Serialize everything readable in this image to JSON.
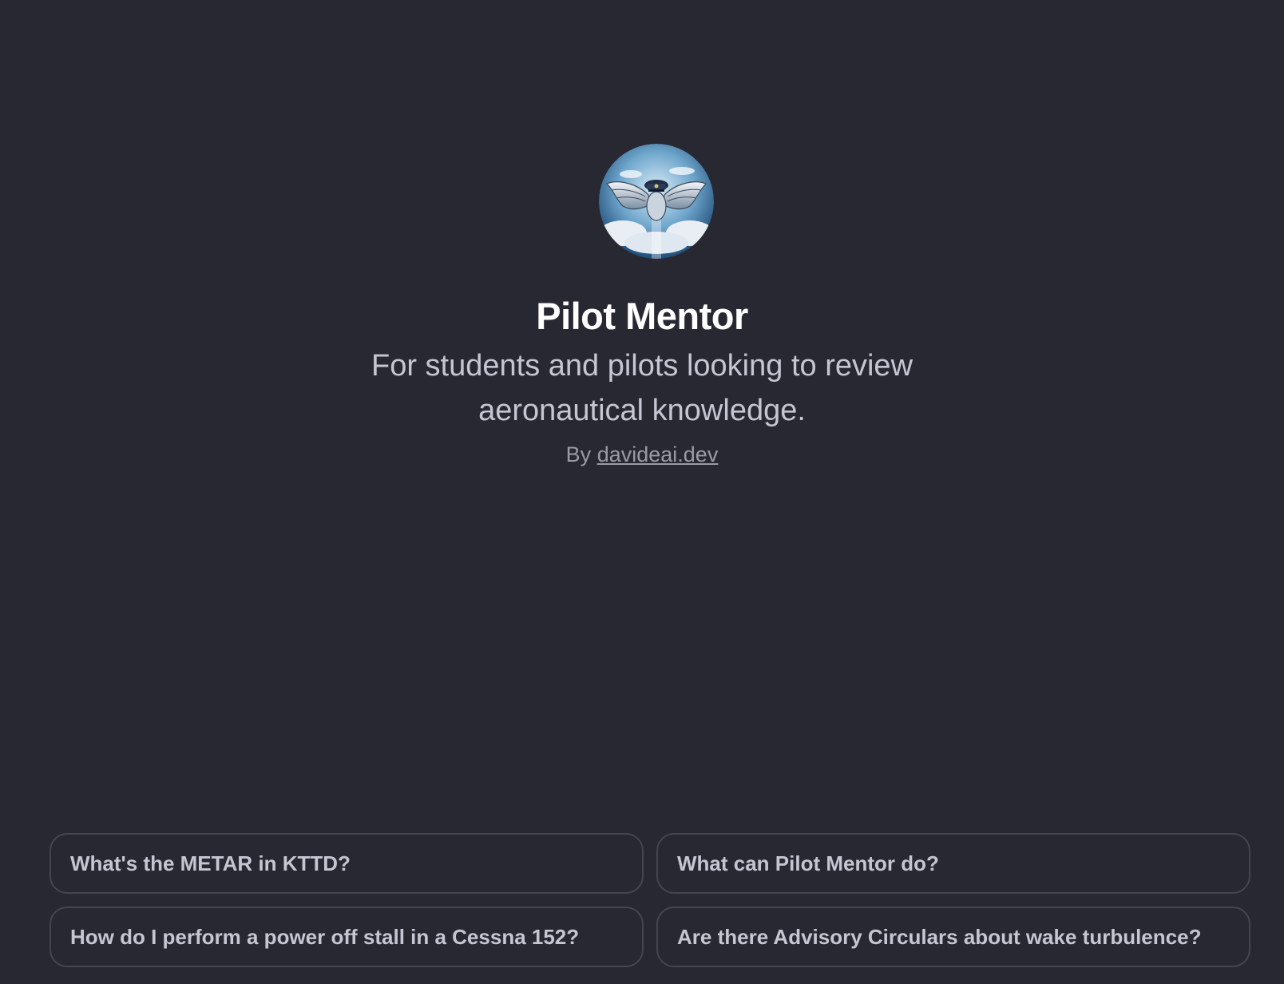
{
  "gpt": {
    "avatar_icon": "pilot-wings-emblem-icon",
    "name": "Pilot Mentor",
    "description": "For students and pilots looking to review aeronautical knowledge.",
    "by_prefix": "By",
    "author": "davideai.dev"
  },
  "prompts": [
    {
      "label": "What's the METAR in KTTD?"
    },
    {
      "label": "What can Pilot Mentor do?"
    },
    {
      "label": "How do I perform a power off stall in a Cessna 152?"
    },
    {
      "label": "Are there Advisory Circulars about wake turbulence?"
    }
  ],
  "colors": {
    "background": "#282833",
    "title": "#ffffff",
    "description": "#c6c6d2",
    "byline": "#9b9ba6",
    "prompt_border": "#454552"
  }
}
